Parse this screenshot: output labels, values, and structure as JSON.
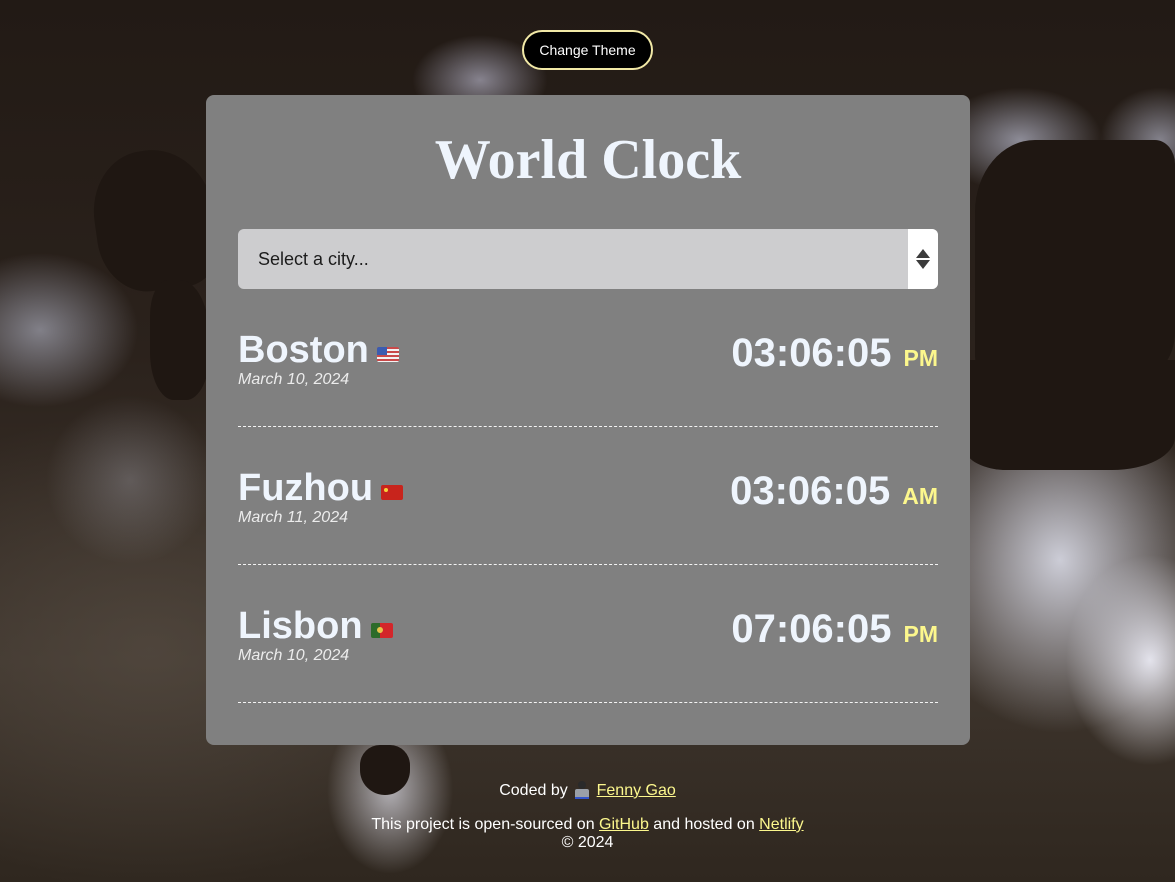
{
  "header": {
    "theme_button_label": "Change Theme"
  },
  "card": {
    "title": "World Clock",
    "city_select": {
      "placeholder": "Select a city..."
    },
    "cities": [
      {
        "name": "Boston",
        "flag": "us-flag-icon",
        "date": "March 10, 2024",
        "time": "03:06:05",
        "ampm": "PM"
      },
      {
        "name": "Fuzhou",
        "flag": "cn-flag-icon",
        "date": "March 11, 2024",
        "time": "03:06:05",
        "ampm": "AM"
      },
      {
        "name": "Lisbon",
        "flag": "pt-flag-icon",
        "date": "March 10, 2024",
        "time": "07:06:05",
        "ampm": "PM"
      }
    ]
  },
  "footer": {
    "coded_by_prefix": "Coded by",
    "coder_icon": "technologist-emoji-icon",
    "author_link": "Fenny Gao",
    "source_prefix": "This project is open-sourced on",
    "github_link": "GitHub",
    "hosted_text": "and hosted on",
    "netlify_link": "Netlify",
    "copyright": "© 2024"
  },
  "colors": {
    "card_bg": "#808080",
    "title_text": "#eff5fd",
    "ampm_accent": "#fcf78d",
    "link_accent": "#fcf78d",
    "button_border": "#f1e8a6"
  }
}
